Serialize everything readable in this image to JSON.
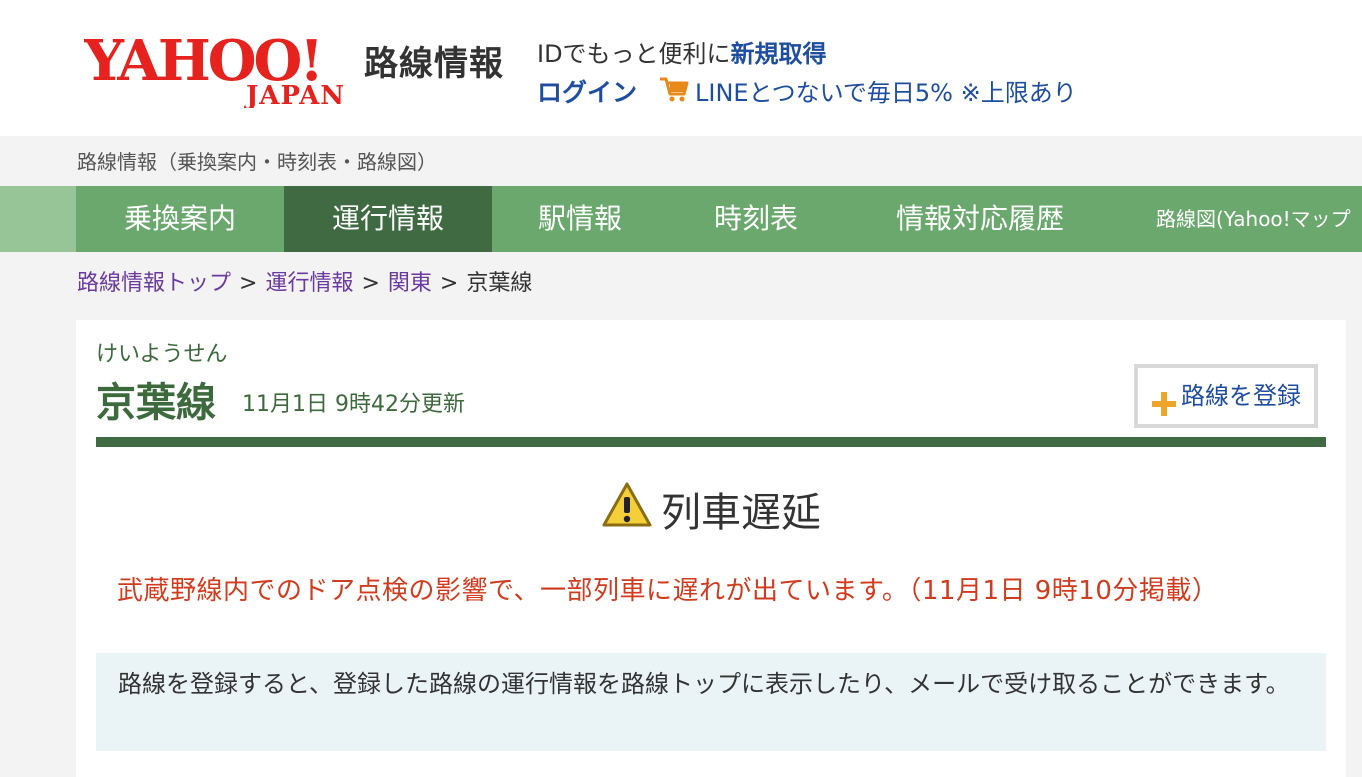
{
  "header": {
    "service_name": "路線情報",
    "id_text": "IDでもっと便利に",
    "id_link": "新規取得",
    "login": "ログイン",
    "line_promo": "LINEとつないで毎日5%",
    "line_note": "※上限あり"
  },
  "subtitle": "路線情報（乗換案内・時刻表・路線図）",
  "nav": {
    "tabs": [
      {
        "label": "乗換案内"
      },
      {
        "label": "運行情報",
        "active": true
      },
      {
        "label": "駅情報"
      },
      {
        "label": "時刻表"
      },
      {
        "label": "情報対応履歴"
      },
      {
        "label": "路線図(Yahoo!マップ"
      }
    ]
  },
  "breadcrumb": {
    "items": [
      "路線情報トップ",
      "運行情報",
      "関東",
      "京葉線"
    ],
    "separator": ">"
  },
  "line": {
    "kana": "けいようせん",
    "name": "京葉線",
    "updated": "11月1日 9時42分更新",
    "register_label": "路線を登録"
  },
  "status": {
    "title": "列車遅延",
    "message": "武蔵野線内でのドア点検の影響で、一部列車に遅れが出ています。（11月1日 9時10分掲載）"
  },
  "info": "路線を登録すると、登録した路線の運行情報を路線トップに表示したり、メールで受け取ることができます。",
  "colors": {
    "nav_green": "#6aa86e",
    "nav_active": "#3f6a42",
    "line_green": "#3d6a3d",
    "alert_red": "#d23c1e",
    "link_blue": "#1e4ea0"
  }
}
